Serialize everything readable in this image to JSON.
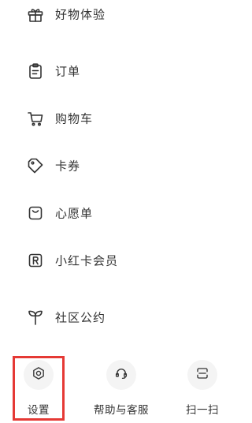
{
  "menu": {
    "items": [
      {
        "label": "好物体验",
        "icon": "gift-icon"
      },
      {
        "label": "订单",
        "icon": "clipboard-icon"
      },
      {
        "label": "购物车",
        "icon": "cart-icon"
      },
      {
        "label": "卡券",
        "icon": "coupon-tag-icon"
      },
      {
        "label": "心愿单",
        "icon": "wishlist-bag-icon"
      },
      {
        "label": "小红卡会员",
        "icon": "membership-card-r-icon"
      },
      {
        "label": "社区公约",
        "icon": "sprout-icon"
      }
    ]
  },
  "bottom": {
    "items": [
      {
        "label": "设置",
        "icon": "gear-icon"
      },
      {
        "label": "帮助与客服",
        "icon": "headset-icon"
      },
      {
        "label": "扫一扫",
        "icon": "scan-icon"
      }
    ]
  },
  "highlight_color": "#e53935"
}
